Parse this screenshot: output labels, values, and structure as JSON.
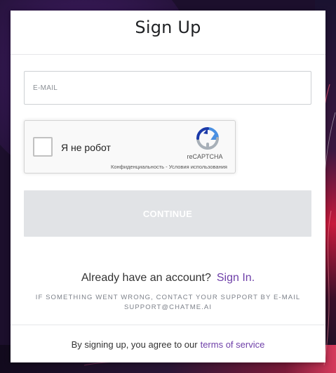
{
  "page": {
    "title": "Sign Up"
  },
  "form": {
    "email_placeholder": "E-MAIL",
    "email_value": "",
    "continue_label": "CONTINUE"
  },
  "recaptcha": {
    "label": "Я не робот",
    "brand": "reCAPTCHA",
    "privacy_link": "Конфиденциальность",
    "separator": " - ",
    "terms_link": "Условия использования",
    "checked": false
  },
  "signin": {
    "prompt": "Already have an account?",
    "link_label": "Sign In."
  },
  "support": {
    "line1": "IF SOMETHING WENT WRONG, CONTACT YOUR SUPPORT BY E-MAIL",
    "line2": "SUPPORT@CHATME.AI"
  },
  "footer": {
    "text": "By signing up, you agree to our",
    "terms_label": "terms of service"
  },
  "colors": {
    "accent": "#6e3fa8",
    "button_disabled": "#e1e3e6",
    "background": "#1c0f2c"
  }
}
